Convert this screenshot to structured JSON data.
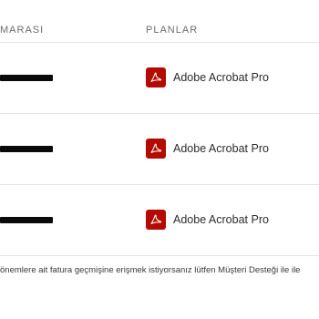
{
  "table": {
    "headers": {
      "account": "MARASI",
      "plans": "PLANLAR"
    },
    "rows": [
      {
        "plan": "Adobe Acrobat Pro",
        "plan_icon": "acrobat-pdf-icon"
      },
      {
        "plan": "Adobe Acrobat Pro",
        "plan_icon": "acrobat-pdf-icon"
      },
      {
        "plan": "Adobe Acrobat Pro",
        "plan_icon": "acrobat-pdf-icon"
      }
    ]
  },
  "footer": {
    "note": "önemlere ait fatura geçmişine erişmek istiyorsanız lütfen Müşteri Desteği ile ile"
  },
  "colors": {
    "acrobat_red": "#b30b00",
    "divider": "#e4e4e4",
    "header_text": "#6e6e6e",
    "body_text": "#2c2c2c"
  }
}
